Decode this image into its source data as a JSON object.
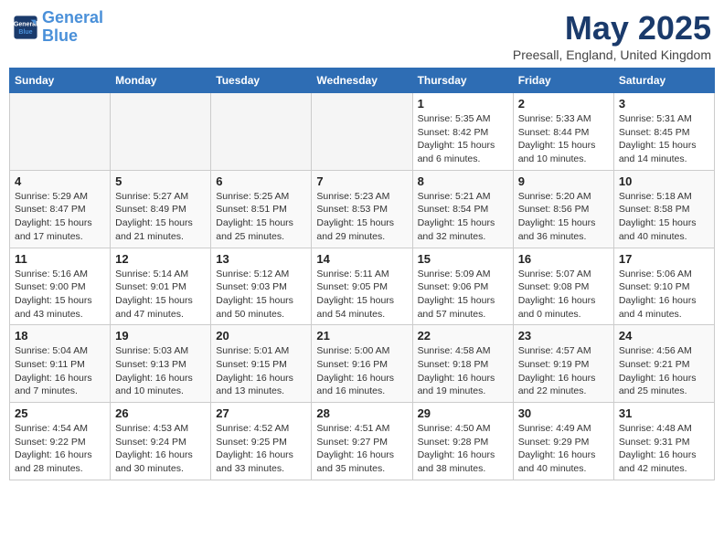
{
  "header": {
    "logo_line1": "General",
    "logo_line2": "Blue",
    "month": "May 2025",
    "location": "Preesall, England, United Kingdom"
  },
  "days_of_week": [
    "Sunday",
    "Monday",
    "Tuesday",
    "Wednesday",
    "Thursday",
    "Friday",
    "Saturday"
  ],
  "weeks": [
    [
      {
        "day": "",
        "text": ""
      },
      {
        "day": "",
        "text": ""
      },
      {
        "day": "",
        "text": ""
      },
      {
        "day": "",
        "text": ""
      },
      {
        "day": "1",
        "text": "Sunrise: 5:35 AM\nSunset: 8:42 PM\nDaylight: 15 hours\nand 6 minutes."
      },
      {
        "day": "2",
        "text": "Sunrise: 5:33 AM\nSunset: 8:44 PM\nDaylight: 15 hours\nand 10 minutes."
      },
      {
        "day": "3",
        "text": "Sunrise: 5:31 AM\nSunset: 8:45 PM\nDaylight: 15 hours\nand 14 minutes."
      }
    ],
    [
      {
        "day": "4",
        "text": "Sunrise: 5:29 AM\nSunset: 8:47 PM\nDaylight: 15 hours\nand 17 minutes."
      },
      {
        "day": "5",
        "text": "Sunrise: 5:27 AM\nSunset: 8:49 PM\nDaylight: 15 hours\nand 21 minutes."
      },
      {
        "day": "6",
        "text": "Sunrise: 5:25 AM\nSunset: 8:51 PM\nDaylight: 15 hours\nand 25 minutes."
      },
      {
        "day": "7",
        "text": "Sunrise: 5:23 AM\nSunset: 8:53 PM\nDaylight: 15 hours\nand 29 minutes."
      },
      {
        "day": "8",
        "text": "Sunrise: 5:21 AM\nSunset: 8:54 PM\nDaylight: 15 hours\nand 32 minutes."
      },
      {
        "day": "9",
        "text": "Sunrise: 5:20 AM\nSunset: 8:56 PM\nDaylight: 15 hours\nand 36 minutes."
      },
      {
        "day": "10",
        "text": "Sunrise: 5:18 AM\nSunset: 8:58 PM\nDaylight: 15 hours\nand 40 minutes."
      }
    ],
    [
      {
        "day": "11",
        "text": "Sunrise: 5:16 AM\nSunset: 9:00 PM\nDaylight: 15 hours\nand 43 minutes."
      },
      {
        "day": "12",
        "text": "Sunrise: 5:14 AM\nSunset: 9:01 PM\nDaylight: 15 hours\nand 47 minutes."
      },
      {
        "day": "13",
        "text": "Sunrise: 5:12 AM\nSunset: 9:03 PM\nDaylight: 15 hours\nand 50 minutes."
      },
      {
        "day": "14",
        "text": "Sunrise: 5:11 AM\nSunset: 9:05 PM\nDaylight: 15 hours\nand 54 minutes."
      },
      {
        "day": "15",
        "text": "Sunrise: 5:09 AM\nSunset: 9:06 PM\nDaylight: 15 hours\nand 57 minutes."
      },
      {
        "day": "16",
        "text": "Sunrise: 5:07 AM\nSunset: 9:08 PM\nDaylight: 16 hours\nand 0 minutes."
      },
      {
        "day": "17",
        "text": "Sunrise: 5:06 AM\nSunset: 9:10 PM\nDaylight: 16 hours\nand 4 minutes."
      }
    ],
    [
      {
        "day": "18",
        "text": "Sunrise: 5:04 AM\nSunset: 9:11 PM\nDaylight: 16 hours\nand 7 minutes."
      },
      {
        "day": "19",
        "text": "Sunrise: 5:03 AM\nSunset: 9:13 PM\nDaylight: 16 hours\nand 10 minutes."
      },
      {
        "day": "20",
        "text": "Sunrise: 5:01 AM\nSunset: 9:15 PM\nDaylight: 16 hours\nand 13 minutes."
      },
      {
        "day": "21",
        "text": "Sunrise: 5:00 AM\nSunset: 9:16 PM\nDaylight: 16 hours\nand 16 minutes."
      },
      {
        "day": "22",
        "text": "Sunrise: 4:58 AM\nSunset: 9:18 PM\nDaylight: 16 hours\nand 19 minutes."
      },
      {
        "day": "23",
        "text": "Sunrise: 4:57 AM\nSunset: 9:19 PM\nDaylight: 16 hours\nand 22 minutes."
      },
      {
        "day": "24",
        "text": "Sunrise: 4:56 AM\nSunset: 9:21 PM\nDaylight: 16 hours\nand 25 minutes."
      }
    ],
    [
      {
        "day": "25",
        "text": "Sunrise: 4:54 AM\nSunset: 9:22 PM\nDaylight: 16 hours\nand 28 minutes."
      },
      {
        "day": "26",
        "text": "Sunrise: 4:53 AM\nSunset: 9:24 PM\nDaylight: 16 hours\nand 30 minutes."
      },
      {
        "day": "27",
        "text": "Sunrise: 4:52 AM\nSunset: 9:25 PM\nDaylight: 16 hours\nand 33 minutes."
      },
      {
        "day": "28",
        "text": "Sunrise: 4:51 AM\nSunset: 9:27 PM\nDaylight: 16 hours\nand 35 minutes."
      },
      {
        "day": "29",
        "text": "Sunrise: 4:50 AM\nSunset: 9:28 PM\nDaylight: 16 hours\nand 38 minutes."
      },
      {
        "day": "30",
        "text": "Sunrise: 4:49 AM\nSunset: 9:29 PM\nDaylight: 16 hours\nand 40 minutes."
      },
      {
        "day": "31",
        "text": "Sunrise: 4:48 AM\nSunset: 9:31 PM\nDaylight: 16 hours\nand 42 minutes."
      }
    ]
  ]
}
